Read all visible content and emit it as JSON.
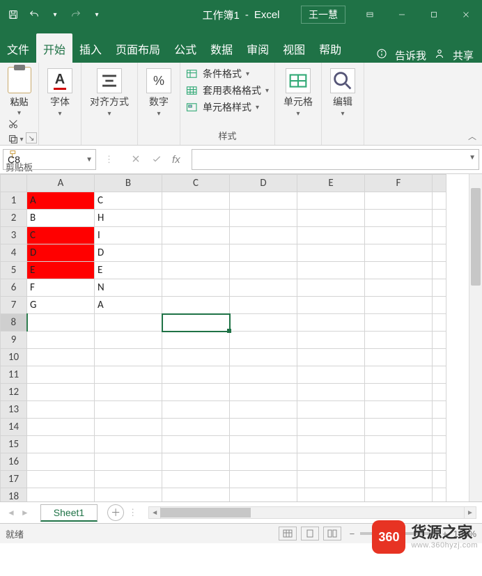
{
  "title": {
    "workbook": "工作簿1",
    "sep": "-",
    "app": "Excel",
    "user": "王一慧"
  },
  "tabs": {
    "file": "文件",
    "home": "开始",
    "insert": "插入",
    "layout": "页面布局",
    "formulas": "公式",
    "data": "数据",
    "review": "审阅",
    "view": "视图",
    "help": "帮助",
    "tellme": "告诉我",
    "share": "共享"
  },
  "ribbon": {
    "clipboard": {
      "paste": "粘贴",
      "group": "剪贴板"
    },
    "font": {
      "label": "字体"
    },
    "align": {
      "label": "对齐方式"
    },
    "number": {
      "label": "数字"
    },
    "styles": {
      "cond": "条件格式",
      "table": "套用表格格式",
      "cell": "单元格样式",
      "group": "样式"
    },
    "cells": {
      "label": "单元格"
    },
    "editing": {
      "label": "编辑"
    }
  },
  "namebox": "C8",
  "formula": "",
  "columns": [
    "A",
    "B",
    "C",
    "D",
    "E",
    "F"
  ],
  "rows": [
    1,
    2,
    3,
    4,
    5,
    6,
    7,
    8,
    9,
    10,
    11,
    12,
    13,
    14,
    15,
    16,
    17,
    18
  ],
  "cells": {
    "A1": "A",
    "A2": "B",
    "A3": "C",
    "A4": "D",
    "A5": "E",
    "A6": "F",
    "A7": "G",
    "B1": "C",
    "B2": "H",
    "B3": "I",
    "B4": "D",
    "B5": "E",
    "B6": "N",
    "B7": "A"
  },
  "redCells": [
    "A1",
    "A3",
    "A4",
    "A5"
  ],
  "selected": "C8",
  "sheet": {
    "name": "Sheet1"
  },
  "status": {
    "ready": "就绪",
    "zoom": "100%"
  },
  "watermark": {
    "badge": "360",
    "title": "货源之家",
    "url": "www.360hyzj.com"
  }
}
